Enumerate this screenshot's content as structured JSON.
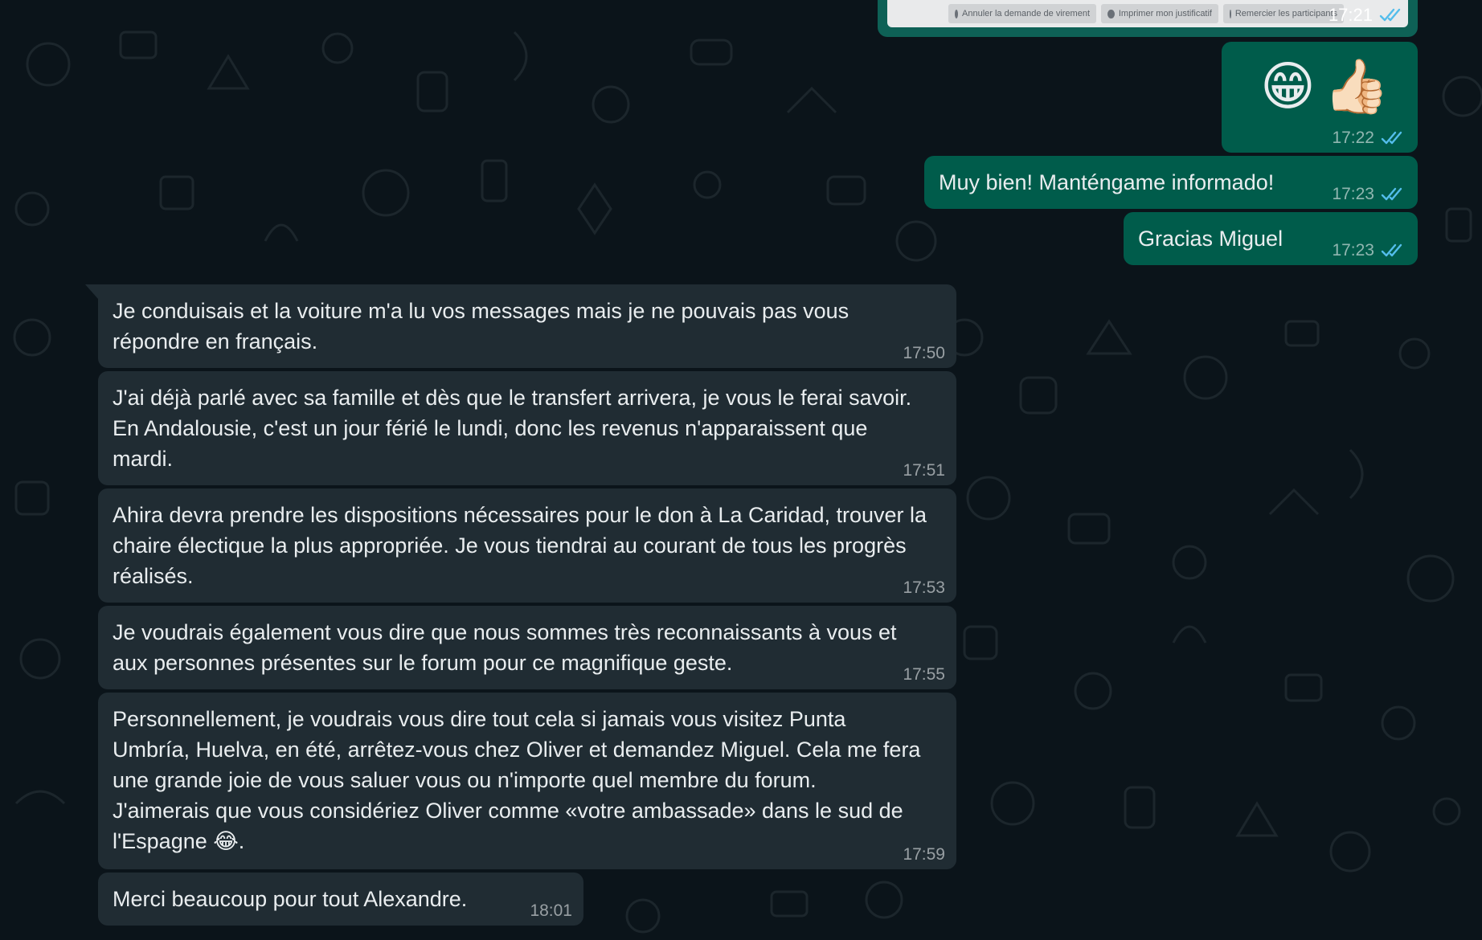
{
  "outgoing": [
    {
      "id": "shot",
      "type": "screenshot",
      "buttons": [
        "Annuler la demande de virement",
        "Imprimer mon justificatif",
        "Remercier les participants"
      ],
      "time": "17:21"
    },
    {
      "id": "emoji",
      "type": "emoji",
      "emojis": [
        "😁",
        "👍🏻"
      ],
      "time": "17:22"
    },
    {
      "id": "m1",
      "text": "Muy bien! Manténgame informado!",
      "time": "17:23"
    },
    {
      "id": "m2",
      "text": "Gracias Miguel",
      "time": "17:23"
    }
  ],
  "incoming": [
    {
      "lines": [
        "Je conduisais et la voiture m'a lu vos messages mais je ne pouvais pas vous",
        "répondre en français."
      ],
      "time": "17:50"
    },
    {
      "lines": [
        "J'ai déjà parlé avec sa famille et dès que le transfert arrivera, je vous le ferai savoir.",
        "En Andalousie, c'est un jour férié le lundi, donc les revenus n'apparaissent que",
        "mardi."
      ],
      "time": "17:51"
    },
    {
      "lines": [
        "Ahira devra prendre les dispositions nécessaires pour le don à La Caridad, trouver la",
        "chaire électique la plus appropriée.  Je vous tiendrai au courant de tous les progrès",
        "réalisés."
      ],
      "time": "17:53"
    },
    {
      "lines": [
        "Je voudrais également vous dire que nous sommes très reconnaissants à vous et",
        "aux personnes présentes sur le forum pour ce magnifique geste."
      ],
      "time": "17:55"
    },
    {
      "lines": [
        "Personnellement, je voudrais vous dire tout cela si jamais vous visitez Punta",
        "Umbría, Huelva, en été, arrêtez-vous chez Oliver et demandez Miguel.  Cela me fera",
        "une grande joie de vous saluer vous ou n'importe quel membre du forum.",
        "J'aimerais que vous considériez Oliver comme «votre ambassade» dans le sud de",
        "l'Espagne 😂."
      ],
      "time": "17:59"
    },
    {
      "lines": [
        "Merci beaucoup pour tout Alexandre."
      ],
      "time": "18:01"
    }
  ],
  "colors": {
    "background": "#0b141a",
    "outgoing_bubble": "#005c4b",
    "incoming_bubble": "#202c33",
    "read_ticks": "#53bdeb"
  }
}
